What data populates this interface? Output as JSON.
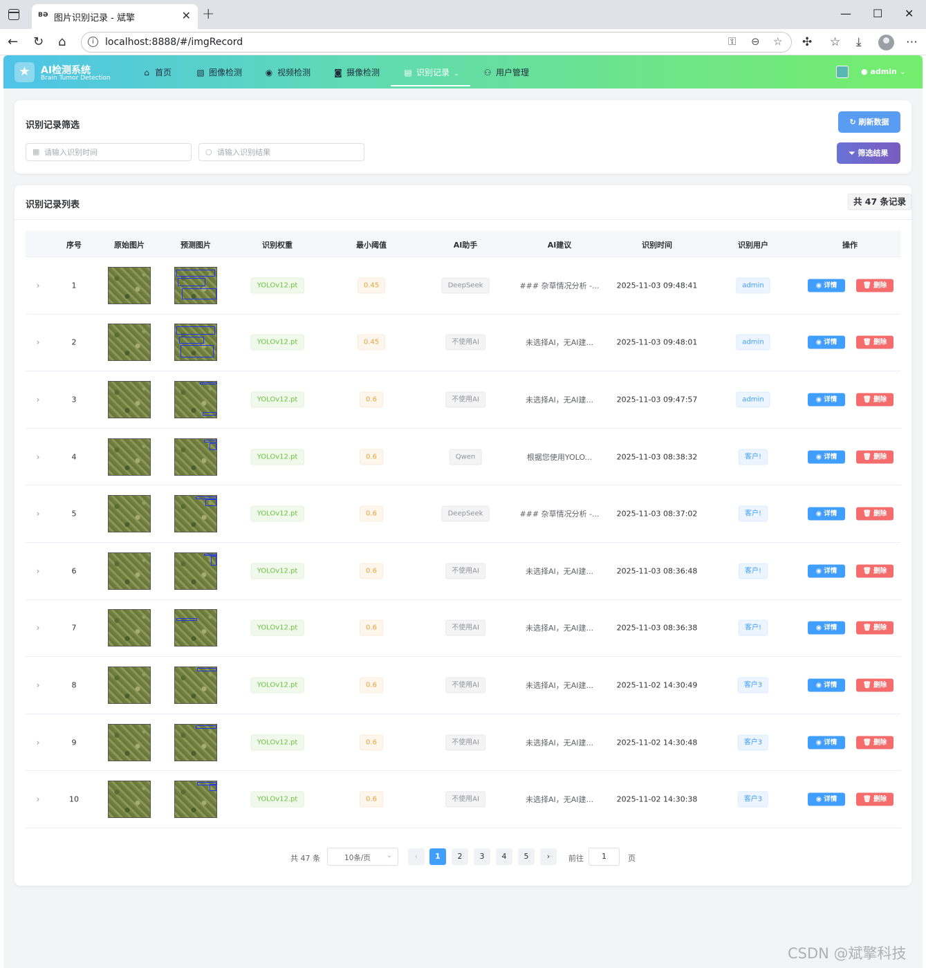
{
  "browser": {
    "tab_title": "图片识别记录 - 斌擎",
    "favicon": "BƏ",
    "url": "localhost:8888/#/imgRecord"
  },
  "header": {
    "logo_title": "AI检测系统",
    "logo_subtitle": "Brain Tumor Detection",
    "menu": [
      {
        "label": "首页",
        "icon": "home-icon"
      },
      {
        "label": "图像检测",
        "icon": "image-icon"
      },
      {
        "label": "视频检测",
        "icon": "play-circle-icon"
      },
      {
        "label": "摄像检测",
        "icon": "camera-icon"
      },
      {
        "label": "识别记录",
        "icon": "document-icon",
        "active": true
      },
      {
        "label": "用户管理",
        "icon": "user-icon"
      }
    ],
    "username": "admin"
  },
  "filter": {
    "title": "识别记录筛选",
    "time_placeholder": "请输入识别时间",
    "result_placeholder": "请输入识别结果",
    "refresh_label": "刷新数据",
    "filter_label": "筛选结果"
  },
  "list": {
    "title": "识别记录列表",
    "total_badge": "共 47 条记录",
    "columns": [
      "序号",
      "原始图片",
      "预测图片",
      "识别权重",
      "最小阈值",
      "AI助手",
      "AI建议",
      "识别时间",
      "识别用户",
      "操作"
    ],
    "detail_label": "详情",
    "delete_label": "删除",
    "rows": [
      {
        "index": "1",
        "weight": "YOLOv12.pt",
        "threshold": "0.45",
        "assistant": "DeepSeek",
        "advice": "### 杂草情况分析 -...",
        "time": "2025-11-03 09:48:41",
        "user": "admin"
      },
      {
        "index": "2",
        "weight": "YOLOv12.pt",
        "threshold": "0.45",
        "assistant": "不使用AI",
        "advice": "未选择AI，无AI建...",
        "time": "2025-11-03 09:48:01",
        "user": "admin"
      },
      {
        "index": "3",
        "weight": "YOLOv12.pt",
        "threshold": "0.6",
        "assistant": "不使用AI",
        "advice": "未选择AI，无AI建...",
        "time": "2025-11-03 09:47:57",
        "user": "admin"
      },
      {
        "index": "4",
        "weight": "YOLOv12.pt",
        "threshold": "0.6",
        "assistant": "Qwen",
        "advice": "根据您使用YOLO...",
        "time": "2025-11-03 08:38:32",
        "user": "客户!"
      },
      {
        "index": "5",
        "weight": "YOLOv12.pt",
        "threshold": "0.6",
        "assistant": "DeepSeek",
        "advice": "### 杂草情况分析 -...",
        "time": "2025-11-03 08:37:02",
        "user": "客户!"
      },
      {
        "index": "6",
        "weight": "YOLOv12.pt",
        "threshold": "0.6",
        "assistant": "不使用AI",
        "advice": "未选择AI，无AI建...",
        "time": "2025-11-03 08:36:48",
        "user": "客户!"
      },
      {
        "index": "7",
        "weight": "YOLOv12.pt",
        "threshold": "0.6",
        "assistant": "不使用AI",
        "advice": "未选择AI，无AI建...",
        "time": "2025-11-03 08:36:38",
        "user": "客户!"
      },
      {
        "index": "8",
        "weight": "YOLOv12.pt",
        "threshold": "0.6",
        "assistant": "不使用AI",
        "advice": "未选择AI，无AI建...",
        "time": "2025-11-02 14:30:49",
        "user": "客户3"
      },
      {
        "index": "9",
        "weight": "YOLOv12.pt",
        "threshold": "0.6",
        "assistant": "不使用AI",
        "advice": "未选择AI，无AI建...",
        "time": "2025-11-02 14:30:48",
        "user": "客户3"
      },
      {
        "index": "10",
        "weight": "YOLOv12.pt",
        "threshold": "0.6",
        "assistant": "不使用AI",
        "advice": "未选择AI，无AI建...",
        "time": "2025-11-02 14:30:38",
        "user": "客户3"
      }
    ]
  },
  "pagination": {
    "total": "共 47 条",
    "page_size": "10条/页",
    "pages": [
      "1",
      "2",
      "3",
      "4",
      "5"
    ],
    "current": "1",
    "goto_label": "前往",
    "goto_value": "1",
    "page_suffix": "页"
  },
  "watermark": "CSDN @斌擎科技",
  "colors": {
    "primary": "#409eff",
    "danger": "#f56c6c",
    "filter_button": "#7a63c8",
    "header_gradient_start": "#4fc3e8",
    "header_gradient_end": "#73ee6d"
  }
}
